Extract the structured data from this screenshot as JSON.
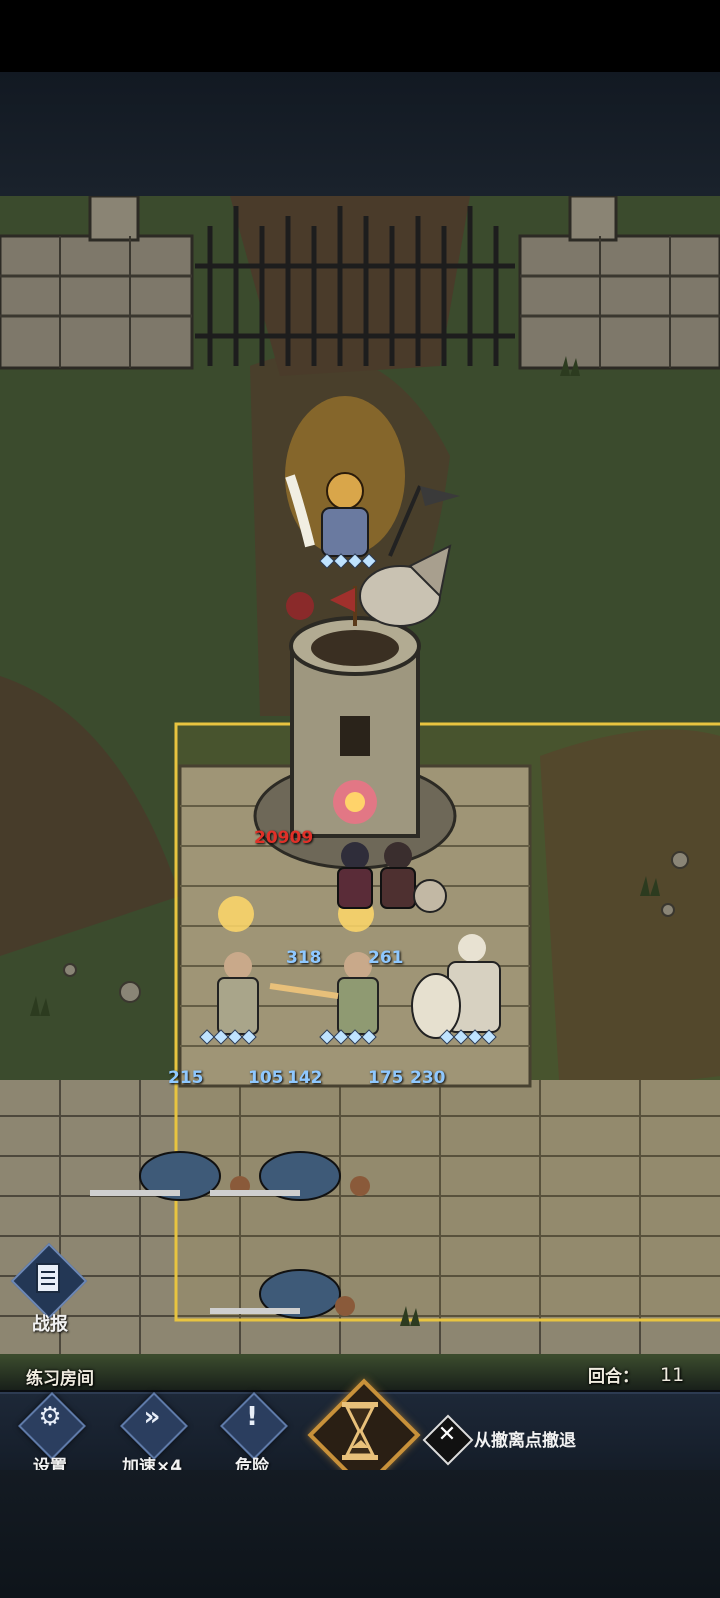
{
  "hud": {
    "report_label": "战报",
    "room_name": "练习房间",
    "round_label": "回合：",
    "round_value": "11"
  },
  "combat": {
    "damage_text": "20909",
    "unit_numbers": [
      "318",
      "261",
      "215",
      "105",
      "142",
      "175",
      "230"
    ]
  },
  "toolbar": {
    "settings_label": "设置",
    "speed_label": "加速×4",
    "danger_label": "危险",
    "retreat_label": "从撤离点撤退"
  },
  "icons": {
    "report": "document-icon",
    "settings": "gear-icon",
    "speed": "fast-forward-icon",
    "danger": "exclamation-icon",
    "hourglass": "hourglass-icon",
    "retreat": "crossed-swords-icon"
  },
  "colors": {
    "damage": "#e03028",
    "unit_number": "#8fc8ff",
    "highlight_zone": "#e8c440",
    "hourglass_frame": "#c8913a"
  }
}
